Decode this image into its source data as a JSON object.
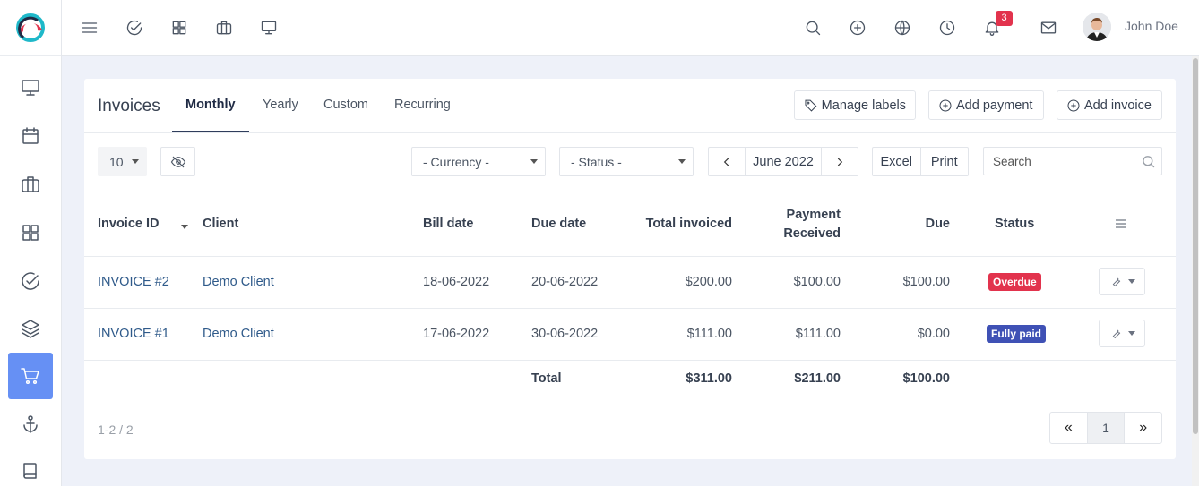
{
  "topbar": {
    "user_name": "John Doe",
    "notification_count": "3",
    "icons": [
      "menu-icon",
      "check-circle-icon",
      "grid-icon",
      "briefcase-icon",
      "monitor-icon",
      "search-icon",
      "plus-circle-icon",
      "globe-icon",
      "clock-icon",
      "bell-icon",
      "mail-icon"
    ]
  },
  "sidebar": {
    "items": [
      {
        "icon": "monitor-icon"
      },
      {
        "icon": "calendar-icon"
      },
      {
        "icon": "briefcase-icon"
      },
      {
        "icon": "grid-icon"
      },
      {
        "icon": "check-circle-icon"
      },
      {
        "icon": "layers-icon"
      },
      {
        "icon": "cart-icon",
        "active": true
      },
      {
        "icon": "anchor-icon"
      },
      {
        "icon": "book-icon"
      }
    ],
    "active_color": "#6690f4"
  },
  "card": {
    "title": "Invoices",
    "tabs": [
      {
        "label": "Monthly",
        "active": true
      },
      {
        "label": "Yearly"
      },
      {
        "label": "Custom"
      },
      {
        "label": "Recurring"
      }
    ],
    "buttons": {
      "manage_labels": "Manage labels",
      "add_payment": "Add payment",
      "add_invoice": "Add invoice"
    }
  },
  "filters": {
    "page_size": "10",
    "currency": "- Currency -",
    "status": "- Status -",
    "period": "June 2022",
    "excel": "Excel",
    "print": "Print",
    "search_placeholder": "Search"
  },
  "table": {
    "headers": {
      "invoice_id": "Invoice ID",
      "client": "Client",
      "bill_date": "Bill date",
      "due_date": "Due date",
      "total_invoiced": "Total invoiced",
      "payment_received_1": "Payment",
      "payment_received_2": "Received",
      "due": "Due",
      "status": "Status"
    },
    "rows": [
      {
        "invoice_id": "INVOICE #2",
        "client": "Demo Client",
        "bill_date": "18-06-2022",
        "due_date": "20-06-2022",
        "total_invoiced": "$200.00",
        "payment_received": "$100.00",
        "due": "$100.00",
        "status": "Overdue",
        "status_color": "#e2334d"
      },
      {
        "invoice_id": "INVOICE #1",
        "client": "Demo Client",
        "bill_date": "17-06-2022",
        "due_date": "30-06-2022",
        "total_invoiced": "$111.00",
        "payment_received": "$111.00",
        "due": "$0.00",
        "status": "Fully paid",
        "status_color": "#3f51b5"
      }
    ],
    "totals": {
      "label": "Total",
      "total_invoiced": "$311.00",
      "payment_received": "$211.00",
      "due": "$100.00"
    }
  },
  "pagination": {
    "info": "1-2 / 2",
    "prev": "«",
    "current": "1",
    "next": "»"
  }
}
